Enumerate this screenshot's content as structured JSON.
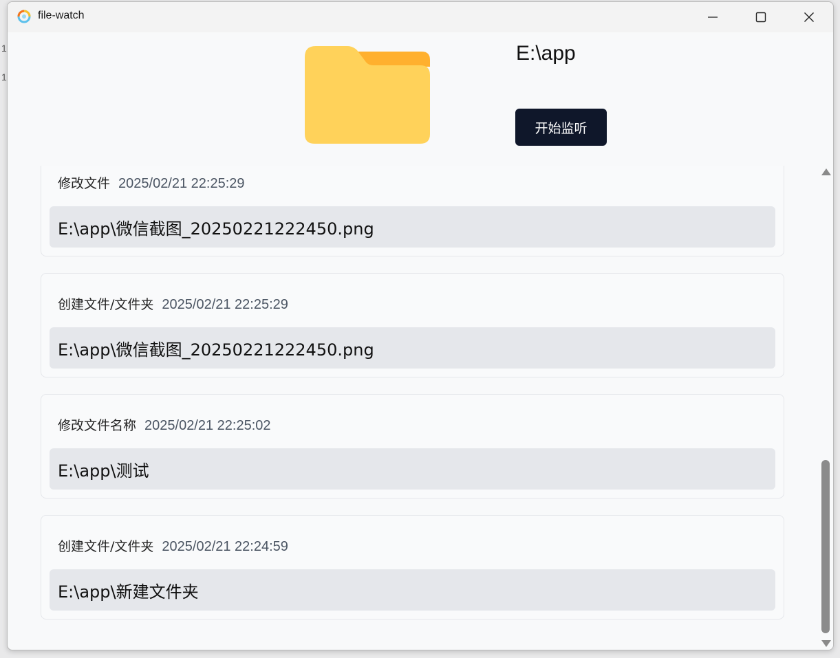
{
  "window": {
    "title": "file-watch"
  },
  "backdrop": {
    "line1": "1",
    "line2": "1"
  },
  "header": {
    "path": "E:\\app",
    "start_button_label": "开始监听"
  },
  "events": [
    {
      "type": "修改文件",
      "time": "2025/02/21 22:25:29",
      "path": "E:\\app\\微信截图_20250221222450.png"
    },
    {
      "type": "创建文件/文件夹",
      "time": "2025/02/21 22:25:29",
      "path": "E:\\app\\微信截图_20250221222450.png"
    },
    {
      "type": "修改文件名称",
      "time": "2025/02/21 22:25:02",
      "path": "E:\\app\\测试"
    },
    {
      "type": "创建文件/文件夹",
      "time": "2025/02/21 22:24:59",
      "path": "E:\\app\\新建文件夹"
    }
  ],
  "colors": {
    "folder_body": "#ffd25a",
    "folder_tab": "#ffb02e",
    "button_bg": "#0f172a"
  }
}
